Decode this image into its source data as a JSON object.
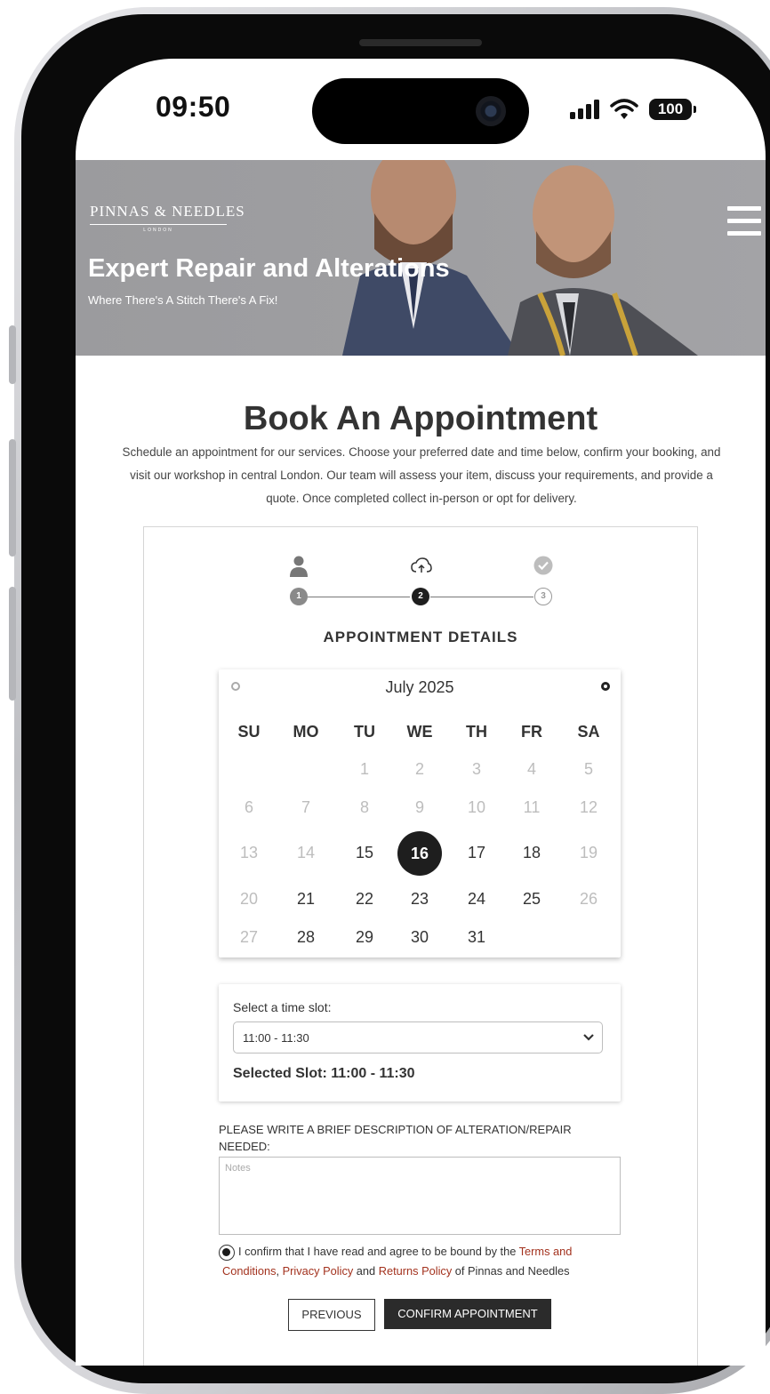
{
  "status_bar": {
    "time": "09:50",
    "battery": "100"
  },
  "hero": {
    "logo": "PINNAS & NEEDLES",
    "logo_sub": "LONDON",
    "title": "Expert Repair and Alterations",
    "subtitle": "Where There's A Stitch There's A Fix!"
  },
  "page": {
    "title": "Book An Appointment",
    "intro": "Schedule an appointment for our services. Choose your preferred date and time below, confirm your booking, and visit our workshop in central London. Our team will assess your item, discuss your requirements, and provide a quote. Once completed collect in-person or opt for delivery."
  },
  "steps": [
    {
      "number": "1",
      "icon": "user-icon",
      "state": "done"
    },
    {
      "number": "2",
      "icon": "cloud-upload-icon",
      "state": "active"
    },
    {
      "number": "3",
      "icon": "check-circle-icon",
      "state": "pending"
    }
  ],
  "section_heading": "APPOINTMENT DETAILS",
  "calendar": {
    "month": "July 2025",
    "weekdays": [
      "SU",
      "MO",
      "TU",
      "WE",
      "TH",
      "FR",
      "SA"
    ],
    "weeks": [
      [
        null,
        null,
        {
          "d": "1",
          "s": "disabled"
        },
        {
          "d": "2",
          "s": "disabled"
        },
        {
          "d": "3",
          "s": "disabled"
        },
        {
          "d": "4",
          "s": "disabled"
        },
        {
          "d": "5",
          "s": "disabled"
        }
      ],
      [
        {
          "d": "6",
          "s": "disabled"
        },
        {
          "d": "7",
          "s": "disabled"
        },
        {
          "d": "8",
          "s": "disabled"
        },
        {
          "d": "9",
          "s": "disabled"
        },
        {
          "d": "10",
          "s": "disabled"
        },
        {
          "d": "11",
          "s": "disabled"
        },
        {
          "d": "12",
          "s": "disabled"
        }
      ],
      [
        {
          "d": "13",
          "s": "disabled"
        },
        {
          "d": "14",
          "s": "disabled"
        },
        {
          "d": "15",
          "s": "enabled"
        },
        {
          "d": "16",
          "s": "selected"
        },
        {
          "d": "17",
          "s": "enabled"
        },
        {
          "d": "18",
          "s": "enabled"
        },
        {
          "d": "19",
          "s": "disabled"
        }
      ],
      [
        {
          "d": "20",
          "s": "disabled"
        },
        {
          "d": "21",
          "s": "enabled"
        },
        {
          "d": "22",
          "s": "enabled"
        },
        {
          "d": "23",
          "s": "enabled"
        },
        {
          "d": "24",
          "s": "enabled"
        },
        {
          "d": "25",
          "s": "enabled"
        },
        {
          "d": "26",
          "s": "disabled"
        }
      ],
      [
        {
          "d": "27",
          "s": "disabled"
        },
        {
          "d": "28",
          "s": "enabled"
        },
        {
          "d": "29",
          "s": "enabled"
        },
        {
          "d": "30",
          "s": "enabled"
        },
        {
          "d": "31",
          "s": "enabled"
        },
        null,
        null
      ]
    ]
  },
  "time_slot": {
    "label": "Select a time slot:",
    "value": "11:00 - 11:30",
    "selected_text": "Selected Slot: 11:00 - 11:30"
  },
  "notes": {
    "label": "PLEASE WRITE A BRIEF DESCRIPTION OF ALTERATION/REPAIR NEEDED:",
    "placeholder": "Notes"
  },
  "consent": {
    "text_before": "I confirm that I have read and agree to be bound by the ",
    "terms": "Terms and Conditions",
    "sep1": ", ",
    "privacy": "Privacy Policy",
    "sep2": " and ",
    "returns": "Returns Policy",
    "text_after": " of Pinnas and Needles"
  },
  "buttons": {
    "previous": "PREVIOUS",
    "confirm": "CONFIRM APPOINTMENT"
  },
  "colors": {
    "link": "#a3321e",
    "selected_day": "#1e1e1e",
    "confirm_button": "#2b2b2b"
  }
}
